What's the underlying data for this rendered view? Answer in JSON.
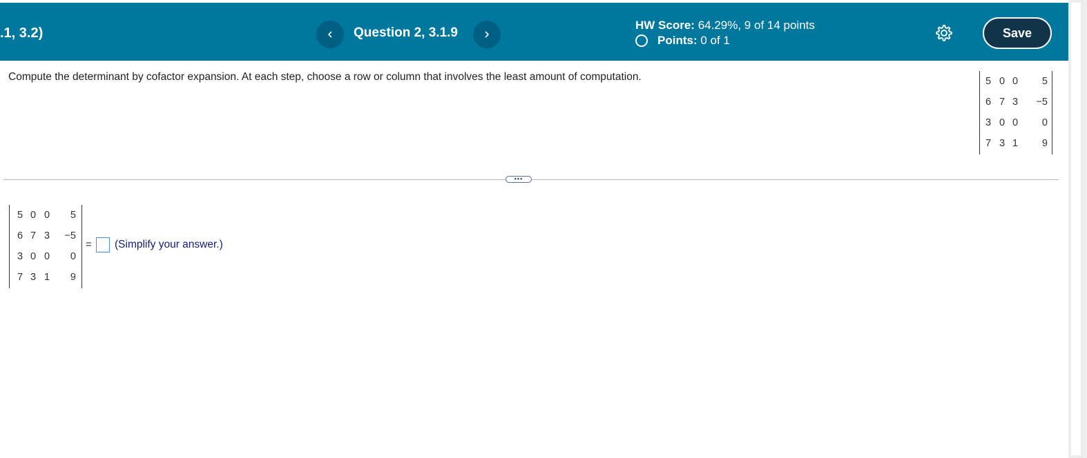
{
  "header": {
    "title_fragment": ".1, 3.2)",
    "question_label": "Question 2, 3.1.9",
    "hw_score_label": "HW Score:",
    "hw_score_value": "64.29%, 9 of 14 points",
    "points_label": "Points:",
    "points_value": "0 of 1",
    "save_label": "Save",
    "prev_icon": "chevron-left-icon",
    "next_icon": "chevron-right-icon",
    "settings_icon": "gear-icon"
  },
  "question": {
    "instruction": "Compute the determinant by cofactor expansion. At each step, choose a row or column that involves the least amount of computation."
  },
  "matrix": {
    "rows": [
      [
        "5",
        "0",
        "0",
        "5"
      ],
      [
        "6",
        "7",
        "3",
        "−5"
      ],
      [
        "3",
        "0",
        "0",
        "0"
      ],
      [
        "7",
        "3",
        "1",
        "9"
      ]
    ]
  },
  "divider": {
    "handle_label": "•••"
  },
  "answer": {
    "equals": "=",
    "value": "",
    "hint": "(Simplify your answer.)"
  },
  "colors": {
    "header_bg": "#00789d",
    "nav_button_bg": "#005f82",
    "save_button_bg": "#12344a",
    "answer_box_border": "#4a90d6",
    "hint_text": "#14207a"
  }
}
